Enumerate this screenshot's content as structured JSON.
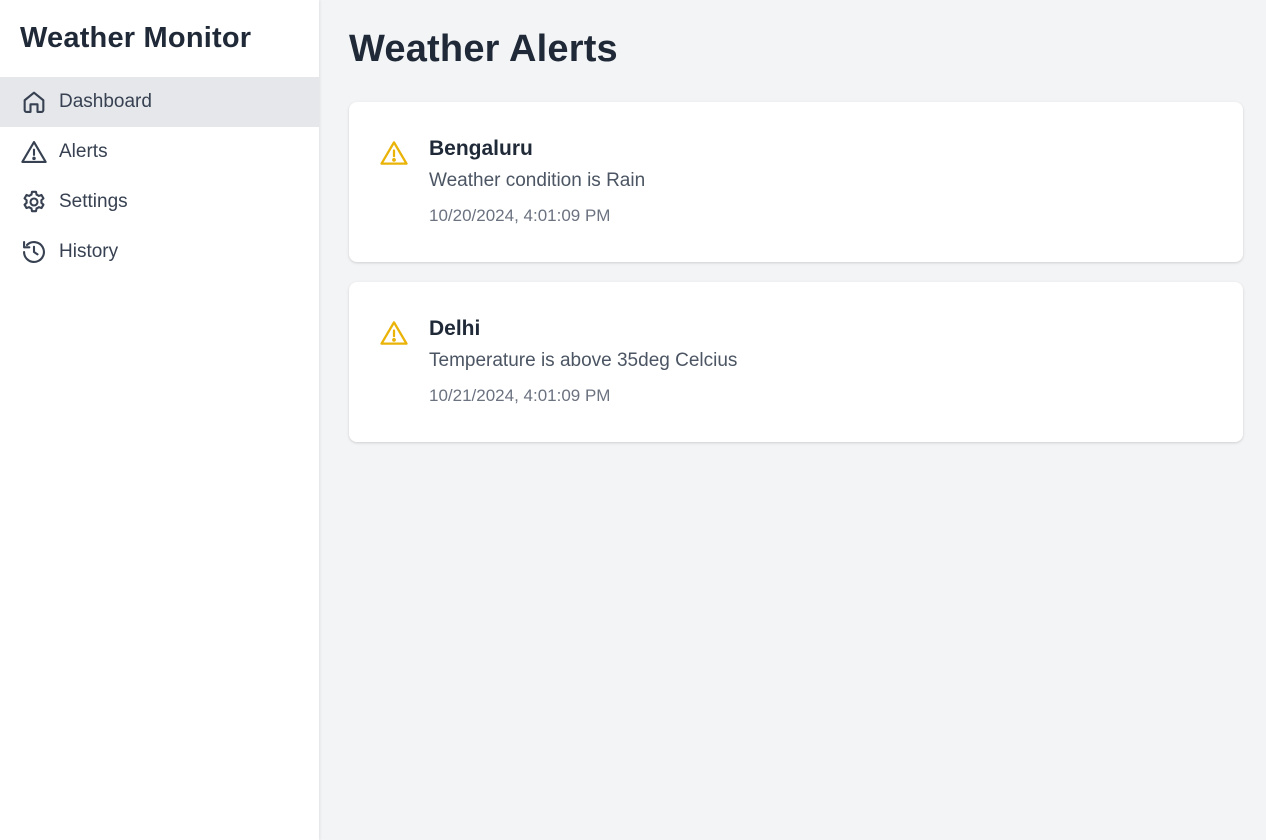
{
  "sidebar": {
    "title": "Weather Monitor",
    "items": [
      {
        "label": "Dashboard",
        "icon": "home-icon",
        "active": true
      },
      {
        "label": "Alerts",
        "icon": "alert-triangle-icon",
        "active": false
      },
      {
        "label": "Settings",
        "icon": "gear-icon",
        "active": false
      },
      {
        "label": "History",
        "icon": "history-icon",
        "active": false
      }
    ]
  },
  "main": {
    "title": "Weather Alerts",
    "alerts": [
      {
        "city": "Bengaluru",
        "message": "Weather condition is Rain",
        "time": "10/20/2024, 4:01:09 PM"
      },
      {
        "city": "Delhi",
        "message": "Temperature is above 35deg Celcius",
        "time": "10/21/2024, 4:01:09 PM"
      }
    ]
  },
  "colors": {
    "sidebar_bg": "#ffffff",
    "main_bg": "#f3f4f6",
    "active_item_bg": "#e5e7eb",
    "warning": "#eab308",
    "text_dark": "#1f2937"
  }
}
